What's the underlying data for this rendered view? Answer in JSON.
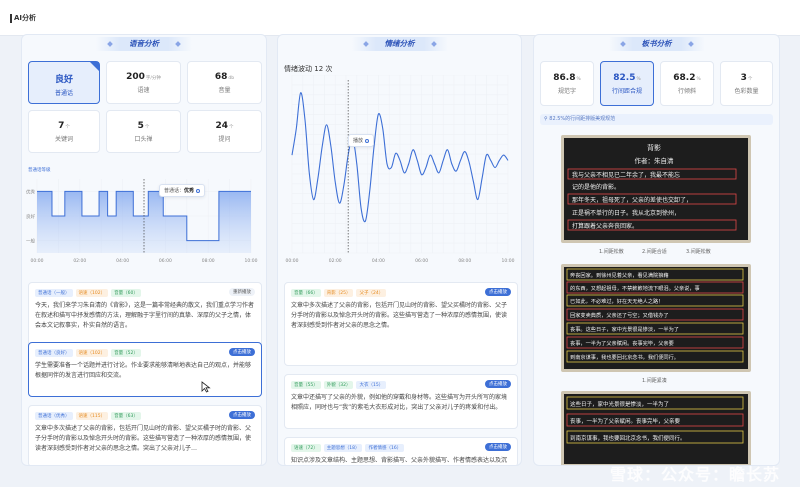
{
  "page_title": "AI分析",
  "voice": {
    "title": "语音分析",
    "stats": [
      {
        "value": "良好",
        "unit": "",
        "label": "普通话"
      },
      {
        "value": "200",
        "unit": "字/分钟",
        "label": "语速"
      },
      {
        "value": "68",
        "unit": "db",
        "label": "音量"
      },
      {
        "value": "7",
        "unit": "个",
        "label": "关键词"
      },
      {
        "value": "5",
        "unit": "个",
        "label": "口头禅"
      },
      {
        "value": "24",
        "unit": "个",
        "label": "提问"
      }
    ],
    "chart_label": "普通话等级",
    "tooltip_prefix": "普通话：",
    "tooltip_value": "优秀",
    "cards": [
      {
        "tags": [
          "普通话（一般）",
          "语速（102）",
          "音量（60）"
        ],
        "play": "重新播放",
        "text": "今天，我们来学习朱自清的《背影》，这是一篇非常经典的散文，我们重点学习作者在叙述和描写中抒发感情的方法，理解融于字里行间的真挚、深厚的父子之情，体会本文记叙事实，朴实自然的语言。"
      },
      {
        "tags": [
          "普通话（良好）",
          "语速（102）",
          "音量（52）"
        ],
        "play": "点击播放",
        "text": "学生需要准备一个话题并进行讨论。作业要求能够清晰地表达自己的观点，并能够根据同伴的发言进行回应和交流。"
      },
      {
        "tags": [
          "普通话（优秀）",
          "语速（115）",
          "音量（63）"
        ],
        "play": "点击播放",
        "text": "文章中多次描述了父亲的背影，包括开门见山时的背影、望父买橘子时的背影、父子分手时的背影以及悼念开头时的背影。这些描写营造了一种浓厚的感情氛围，使读者深刻感受到作者对父亲的思念之情。突出了父亲对儿子…"
      }
    ]
  },
  "emotion": {
    "title": "情绪分析",
    "summary_prefix": "情绪波动",
    "summary_count": "12",
    "summary_suffix": "次",
    "tooltip": "播放",
    "cards": [
      {
        "tags": [
          "音量（66）",
          "背影（25）",
          "父子（24）"
        ],
        "play": "点击播放",
        "text": "文章中多次描述了父亲的背影，包括开门见山时的背影、望父买橘时的背影、父子分手时的背影以及悼念开头时的背影。这些描写营造了一种浓厚的感情氛围，使读者深刻感受到作者对父亲的思念之情。"
      },
      {
        "tags": [
          "音量（55）",
          "外貌（32）",
          "大衣（15）"
        ],
        "play": "点击播放",
        "text": "文章中还描写了父亲的外貌，例如他的穿戴和身材等。这些描写为开头所写的家境相照应，同时也与“我”的紫毛大衣形成对比，突出了父亲对儿子的疼爱和付出。"
      },
      {
        "tags": [
          "语速（72）",
          "主题思想（18）",
          "作者情感（16）"
        ],
        "play": "点击播放",
        "text": "知识点涉及文章结构、主题思想、背影描写、父亲外貌描写、作者情感表达以及沉淀描写等方面。这些知识点有助于深入理解这篇感人至深的散文。"
      }
    ]
  },
  "board": {
    "title": "板书分析",
    "stats": [
      {
        "value": "86.8",
        "unit": "%",
        "label": "规范字"
      },
      {
        "value": "82.5",
        "unit": "%",
        "label": "行间距合规"
      },
      {
        "value": "68.2",
        "unit": "%",
        "label": "行倾斜"
      },
      {
        "value": "3",
        "unit": "个",
        "label": "色彩数量"
      }
    ],
    "hint": "82.5%的行间距排版美观规范",
    "captions": [
      "1.间距松散",
      "2.间距合适",
      "3.间距松散",
      "1.间距紧凑"
    ],
    "board1_lines": [
      "背影",
      "作者：朱自清",
      "我与父亲不相见已二年余了，我最不能忘",
      "记的是他的背影。",
      "那年冬天，祖母死了，父亲的差使也交卸了，",
      "正是祸不单行的日子。我从北京到徐州，",
      "打算跟着父亲奔丧回家。"
    ],
    "board2_lines": [
      "奔丧回家。到徐州见着父亲，看见满院狼藉",
      "的东西，又想起祖母，不禁簌簌地流下眼泪。父亲说，事",
      "已如此，不必难过，好在天无绝人之路！",
      "回家变卖典质，父亲还了亏空；又借钱办了",
      "丧事。这些日子，家中光景很是惨淡，一半为了",
      "丧事，一半为了父亲赋闲。丧事完毕，父亲要",
      "到南京谋事，我也要回北京念书，我们便同行。"
    ],
    "board3_lines": [
      "这些日子，家中光景很是惨淡，一半为了",
      "丧事，一半为了父亲赋闲。丧事完毕，父亲要",
      "到南京谋事，我也要回北京念书，我们便同行。"
    ]
  },
  "watermark": "雪球：公众号：瞻长苏",
  "chart_data": [
    {
      "type": "line",
      "title": "普通话等级",
      "x_ticks": [
        "00:00",
        "02:00",
        "04:00",
        "06:00",
        "08:00",
        "10:00"
      ],
      "y_ticks": [
        "优秀",
        "良好",
        "一般"
      ],
      "x": [
        0,
        0.7,
        0.7,
        1.3,
        1.3,
        2.1,
        2.1,
        2.9,
        2.9,
        3.3,
        3.3,
        3.7,
        3.7,
        4.5,
        4.5,
        5.2,
        5.2,
        5.9,
        5.9,
        7.0,
        7.0,
        8.5,
        8.5,
        10.0
      ],
      "y": [
        3,
        3,
        2,
        2,
        3,
        3,
        2,
        2,
        3,
        3,
        2,
        2,
        3,
        3,
        2,
        2,
        3,
        3,
        2,
        2,
        1,
        1,
        3,
        3
      ],
      "cursor_x": 5.0,
      "ylim": [
        0.5,
        3.5
      ],
      "xlim": [
        0,
        10
      ]
    },
    {
      "type": "line",
      "title": "情绪波动",
      "x_ticks": [
        "00:00",
        "02:00",
        "04:00",
        "06:00",
        "08:00",
        "10:00"
      ],
      "x": [
        0,
        0.2,
        0.4,
        0.6,
        0.8,
        1.0,
        1.2,
        1.4,
        1.6,
        1.8,
        2.0,
        2.2,
        2.4,
        2.6,
        2.8,
        3.0,
        3.2,
        3.4,
        3.6,
        3.8,
        4.0,
        4.2,
        4.4,
        4.6,
        4.8,
        5.0,
        5.2,
        5.4,
        5.6,
        5.8,
        6.0,
        6.2,
        6.4,
        6.6,
        6.8,
        7.0,
        7.2,
        7.4,
        7.6,
        7.8,
        8.0,
        8.2,
        8.4,
        8.6,
        8.8,
        9.0,
        9.2,
        9.4,
        9.6,
        9.8,
        10.0
      ],
      "y": [
        55,
        70,
        90,
        75,
        45,
        30,
        42,
        60,
        72,
        60,
        40,
        28,
        38,
        55,
        65,
        50,
        25,
        18,
        35,
        60,
        78,
        70,
        50,
        48,
        56,
        52,
        45,
        50,
        58,
        52,
        44,
        48,
        55,
        50,
        45,
        52,
        58,
        50,
        46,
        52,
        57,
        51,
        40,
        30,
        42,
        55,
        52,
        48,
        52,
        55,
        52
      ],
      "cursor_x": 2.6,
      "xlim": [
        0,
        10
      ],
      "ylim": [
        0,
        100
      ]
    }
  ]
}
